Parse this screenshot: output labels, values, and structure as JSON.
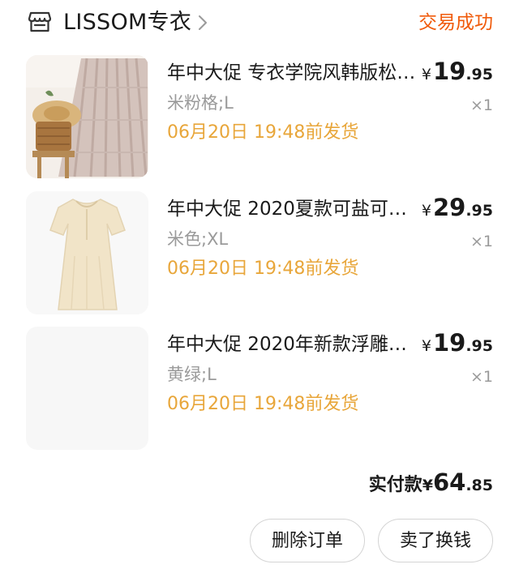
{
  "shop": {
    "name": "LISSOM专衣",
    "status": "交易成功"
  },
  "items": [
    {
      "title": "年中大促  专衣学院风韩版松…",
      "price_int": "19",
      "price_dec": ".95",
      "sku": "米粉格;L",
      "qty": "×1",
      "ship": "06月20日  19:48前发货"
    },
    {
      "title": "年中大促  2020夏款可盐可…",
      "price_int": "29",
      "price_dec": ".95",
      "sku": "米色;XL",
      "qty": "×1",
      "ship": "06月20日  19:48前发货"
    },
    {
      "title": "年中大促  2020年新款浮雕…",
      "price_int": "19",
      "price_dec": ".95",
      "sku": "黄绿;L",
      "qty": "×1",
      "ship": "06月20日  19:48前发货"
    }
  ],
  "currency": "¥",
  "total": {
    "label": "实付款",
    "int": "64",
    "dec": ".85"
  },
  "actions": {
    "delete_order": "删除订单",
    "sell_resell": "卖了换钱"
  },
  "colors": {
    "status": "#f05a0a",
    "ship": "#e8a63a",
    "muted": "#9a9a9a"
  }
}
